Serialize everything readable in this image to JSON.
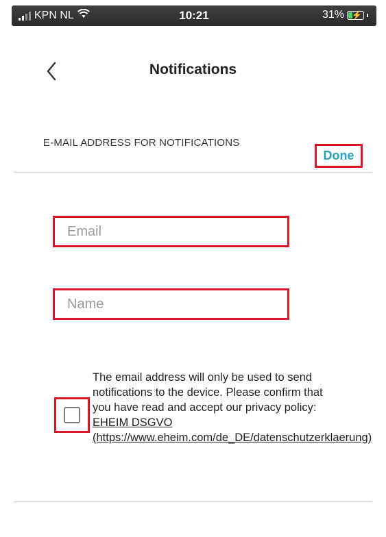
{
  "status_bar": {
    "carrier": "KPN NL",
    "time": "10:21",
    "battery_percent": "31%",
    "signal_icon": "signal-bars-icon",
    "wifi_icon": "wifi-icon",
    "battery_icon": "battery-charging-icon",
    "battery_level": 0.31
  },
  "header": {
    "back_icon": "chevron-left-icon",
    "title": "Notifications"
  },
  "section": {
    "label": "E-MAIL ADDRESS FOR NOTIFICATIONS",
    "done_label": "Done"
  },
  "form": {
    "email": {
      "value": "",
      "placeholder": "Email"
    },
    "name": {
      "value": "",
      "placeholder": "Name"
    }
  },
  "consent": {
    "checked": false,
    "text": "The email address will only be used to send notifications to the device. Please confirm that you have read and accept our privacy policy:",
    "link_text": "EHEIM DSGVO (https://www.eheim.com/de_DE/datenschutzerklaerung)"
  },
  "colors": {
    "accent": "#26a3b7",
    "highlight": "#d7182a",
    "status_bar_bg": "#333333",
    "battery_fill": "#4cd964",
    "divider": "#cfcfcf"
  }
}
